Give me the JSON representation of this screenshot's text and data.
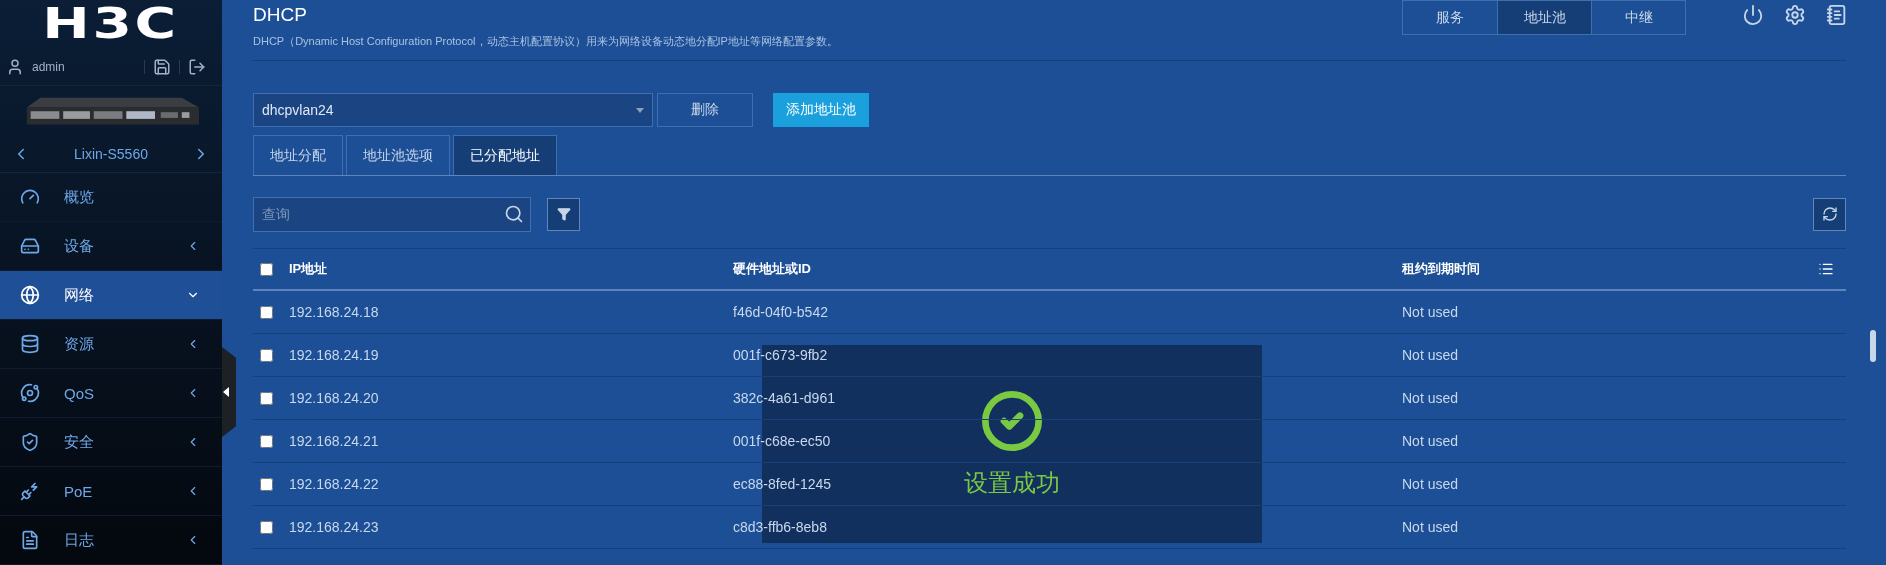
{
  "sidebar": {
    "logo": "H3C",
    "user": "admin",
    "device": {
      "name": "Lixin-S5560"
    },
    "items": [
      {
        "label": "概览",
        "kind": "link",
        "selected": false
      },
      {
        "label": "设备",
        "kind": "group",
        "selected": false,
        "expanded": false
      },
      {
        "label": "网络",
        "kind": "group",
        "selected": true,
        "expanded": true
      },
      {
        "label": "资源",
        "kind": "group",
        "selected": false,
        "expanded": false
      },
      {
        "label": "QoS",
        "kind": "group",
        "selected": false,
        "expanded": false
      },
      {
        "label": "安全",
        "kind": "group",
        "selected": false,
        "expanded": false
      },
      {
        "label": "PoE",
        "kind": "group",
        "selected": false,
        "expanded": false
      },
      {
        "label": "日志",
        "kind": "group",
        "selected": false,
        "expanded": false
      }
    ]
  },
  "header": {
    "title": "DHCP",
    "description": "DHCP（Dynamic Host Configuration Protocol，动态主机配置协议）用来为网络设备动态地分配IP地址等网络配置参数。",
    "tabs": [
      {
        "label": "服务",
        "selected": false
      },
      {
        "label": "地址池",
        "selected": true
      },
      {
        "label": "中继",
        "selected": false
      }
    ]
  },
  "pool": {
    "value": "dhcpvlan24",
    "buttons": [
      {
        "label": "删除",
        "kind": "secondary"
      },
      {
        "label": "添加地址池",
        "kind": "primary"
      }
    ]
  },
  "tabs": [
    {
      "label": "地址分配",
      "selected": false
    },
    {
      "label": "地址池选项",
      "selected": false
    },
    {
      "label": "已分配地址",
      "selected": true
    }
  ],
  "search": {
    "placeholder": "查询"
  },
  "table": {
    "select_all_checked": false,
    "columns": [
      "IP地址",
      "硬件地址或ID",
      "租约到期时间"
    ],
    "rows": [
      {
        "checked": false,
        "cells": [
          "192.168.24.18",
          "f46d-04f0-b542",
          "Not used"
        ]
      },
      {
        "checked": false,
        "cells": [
          "192.168.24.19",
          "001f-c673-9fb2",
          "Not used"
        ]
      },
      {
        "checked": false,
        "cells": [
          "192.168.24.20",
          "382c-4a61-d961",
          "Not used"
        ]
      },
      {
        "checked": false,
        "cells": [
          "192.168.24.21",
          "001f-c68e-ec50",
          "Not used"
        ]
      },
      {
        "checked": false,
        "cells": [
          "192.168.24.22",
          "ec88-8fed-1245",
          "Not used"
        ]
      },
      {
        "checked": false,
        "cells": [
          "192.168.24.23",
          "c8d3-ffb6-8eb8",
          "Not used"
        ]
      }
    ]
  },
  "toast": {
    "message": "设置成功"
  }
}
